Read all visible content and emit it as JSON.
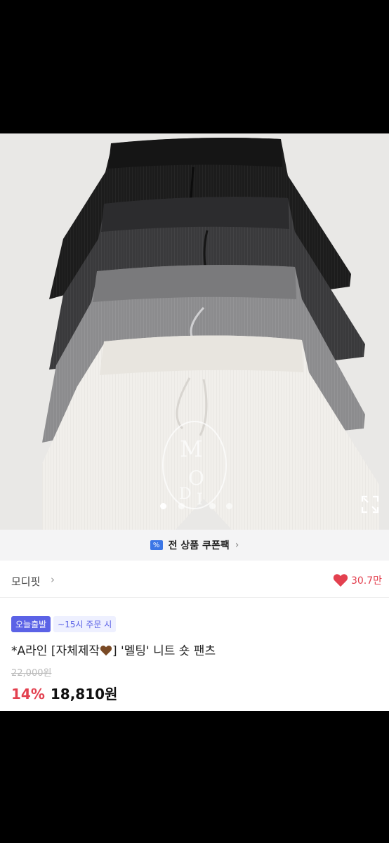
{
  "image": {
    "watermark_text": "MODI",
    "pagination": {
      "total": 4,
      "active": 1
    },
    "short_colors": [
      "black",
      "charcoal",
      "gray",
      "white"
    ]
  },
  "coupon": {
    "label": "전 상품 쿠폰팩",
    "icon": "coupon-percent-icon"
  },
  "store": {
    "name": "모디핏",
    "likes": "30.7만"
  },
  "badges": {
    "primary": "오늘출발",
    "secondary": "~15시 주문 시"
  },
  "product": {
    "title_prefix": "*A라인 [자체제작",
    "title_suffix": "] '멜팅' 니트 숏 팬츠",
    "original_price": "22,000원",
    "discount": "14%",
    "price": "18,810원"
  },
  "colors": {
    "accent": "#e3404f",
    "badge": "#5b62e6",
    "coupon_blue": "#3b76e6"
  }
}
